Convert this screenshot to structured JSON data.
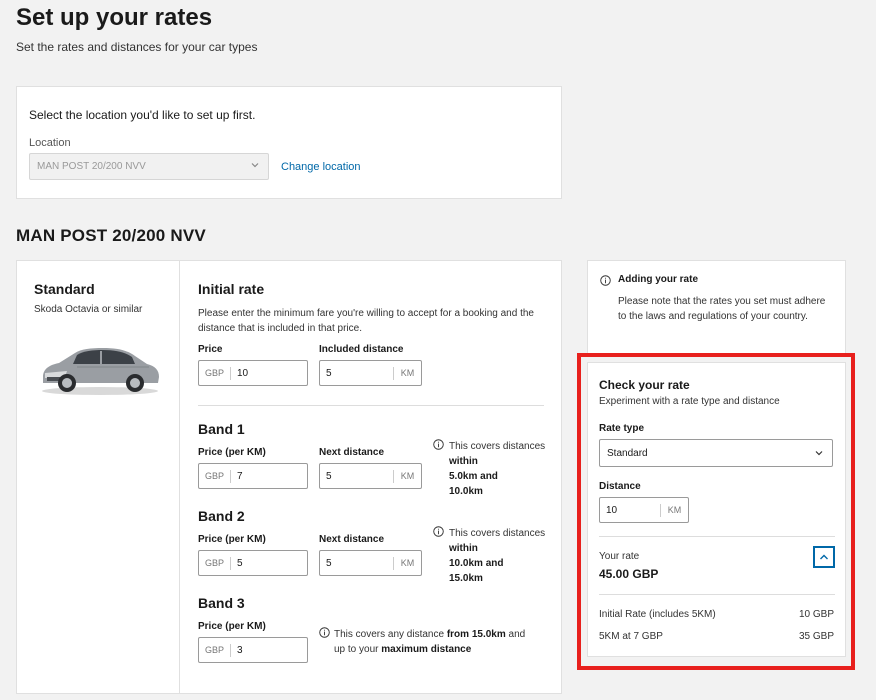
{
  "page": {
    "title": "Set up your rates",
    "subtitle": "Set the rates and distances for your car types"
  },
  "location": {
    "prompt": "Select the location you'd like to set up first.",
    "label": "Location",
    "selected": "MAN POST 20/200 NVV",
    "change_link": "Change location"
  },
  "section_title": "MAN POST 20/200 NVV",
  "car": {
    "name": "Standard",
    "model": "Skoda Octavia or similar"
  },
  "initial_rate": {
    "title": "Initial rate",
    "description": "Please enter the minimum fare you're willing to accept for a booking and the distance that is included in that price.",
    "price_label": "Price",
    "price_currency": "GBP",
    "price_value": "10",
    "distance_label": "Included distance",
    "distance_value": "5",
    "distance_unit": "KM"
  },
  "bands": [
    {
      "title": "Band 1",
      "price_label": "Price (per KM)",
      "currency": "GBP",
      "price_value": "7",
      "distance_label": "Next distance",
      "distance_value": "5",
      "distance_unit": "KM",
      "note_pre": "This covers distances ",
      "note_within": "within",
      "note_range_a": "5.0km and",
      "note_range_b": "10.0km"
    },
    {
      "title": "Band 2",
      "price_label": "Price (per KM)",
      "currency": "GBP",
      "price_value": "5",
      "distance_label": "Next distance",
      "distance_value": "5",
      "distance_unit": "KM",
      "note_pre": "This covers distances ",
      "note_within": "within",
      "note_range_a": "10.0km and",
      "note_range_b": "15.0km"
    },
    {
      "title": "Band 3",
      "price_label": "Price (per KM)",
      "currency": "GBP",
      "price_value": "3",
      "note_a": "This covers any distance ",
      "note_b": "from 15.0km",
      "note_c": " and",
      "note_d": "up to your ",
      "note_e": "maximum distance"
    }
  ],
  "info_panel": {
    "title": "Adding your rate",
    "text": "Please note that the rates you set must adhere to the laws and regulations of your country."
  },
  "check_rate": {
    "title": "Check your rate",
    "subtitle": "Experiment with a rate type and distance",
    "rate_type_label": "Rate type",
    "rate_type_value": "Standard",
    "distance_label": "Distance",
    "distance_value": "10",
    "distance_unit": "KM",
    "your_rate_label": "Your rate",
    "your_rate_value": "45.00 GBP",
    "breakdown": [
      {
        "label": "Initial Rate (includes 5KM)",
        "amount": "10 GBP"
      },
      {
        "label": "5KM at 7 GBP",
        "amount": "35 GBP"
      }
    ]
  },
  "colors": {
    "accent": "#0068a8",
    "highlight": "#e8201d"
  }
}
